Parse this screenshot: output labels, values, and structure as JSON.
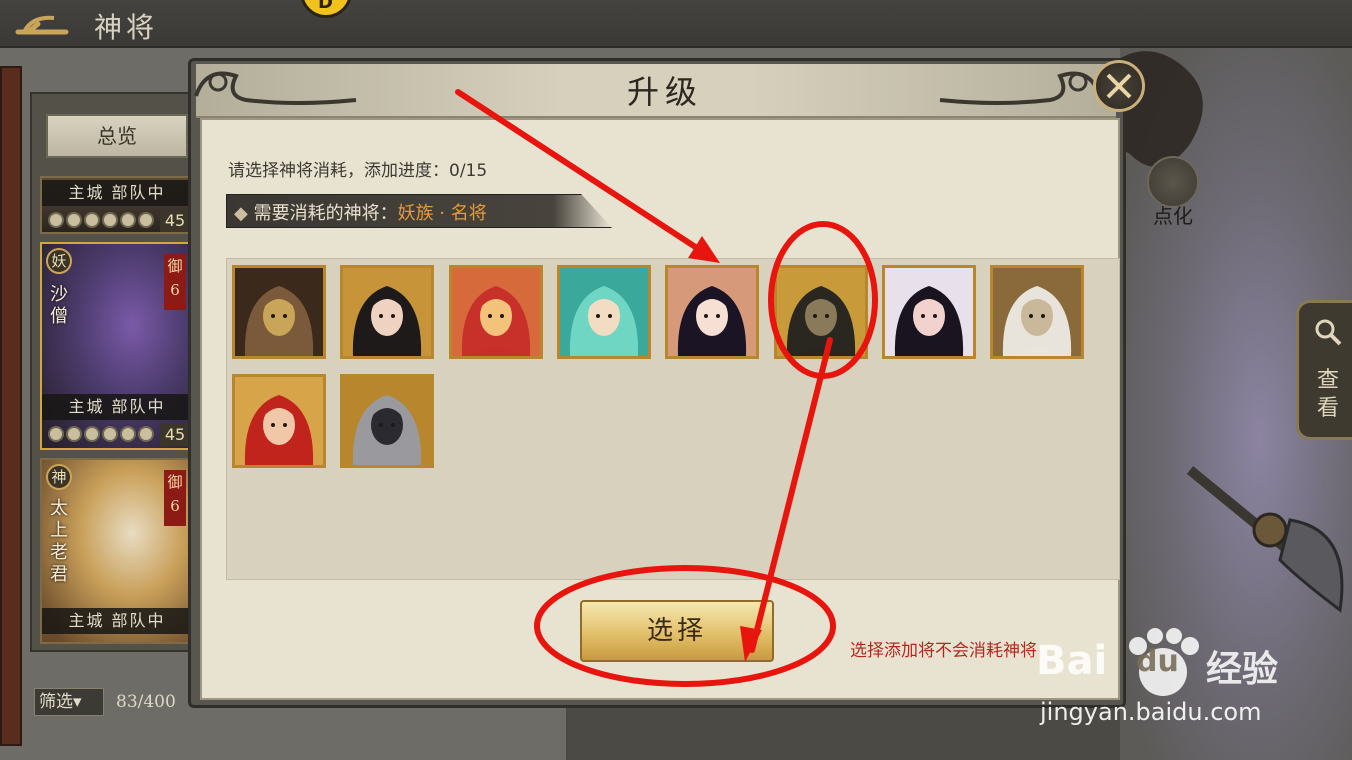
{
  "screen": {
    "title": "神将"
  },
  "side_buttons": {
    "dianhua": "点化",
    "chakan": "查看"
  },
  "roster": {
    "overview_label": "总览",
    "cards": [
      {
        "status": "主城 部队中",
        "level": "45"
      },
      {
        "faction": "妖",
        "name": "沙僧",
        "rank": "御6",
        "status": "主城 部队中",
        "level": "45"
      },
      {
        "faction": "神",
        "name": "太上老君",
        "rank": "御6",
        "status": "主城 部队中"
      }
    ],
    "filter_label": "筛选▾",
    "count": "83/400"
  },
  "dialog": {
    "title": "升级",
    "prompt_prefix": "请选择神将消耗，添加进度：",
    "prompt_progress": "0/15",
    "requirement_label": "需要消耗的神将：",
    "requirement_value": "妖族 · 名将",
    "select_button": "选择",
    "note": "选择添加将不会消耗神将"
  },
  "hero_tiles": [
    {
      "icon": "hero-portrait-lion-demon",
      "colors": [
        "#3b2a1c",
        "#7a5a3a",
        "#c9a55a"
      ]
    },
    {
      "icon": "hero-portrait-black-hair-maiden",
      "colors": [
        "#c8943a",
        "#1f1a1a",
        "#f0d2c0"
      ]
    },
    {
      "icon": "hero-portrait-red-flame-boy",
      "colors": [
        "#d66a3a",
        "#c8302a",
        "#f4c27a"
      ]
    },
    {
      "icon": "hero-portrait-teal-hair-warrior",
      "colors": [
        "#3aa89a",
        "#6fd6c4",
        "#f2dcc2"
      ]
    },
    {
      "icon": "hero-portrait-flower-princess",
      "colors": [
        "#d69a7a",
        "#1a1424",
        "#f6e0d4"
      ]
    },
    {
      "icon": "hero-portrait-dark-bearded-man",
      "colors": [
        "#c89a3a",
        "#2a2620",
        "#8a7a5a"
      ]
    },
    {
      "icon": "hero-portrait-fox-lady",
      "colors": [
        "#e8e0ea",
        "#1a1420",
        "#f2d2cc"
      ]
    },
    {
      "icon": "hero-portrait-white-hair-elder",
      "colors": [
        "#8a6a3a",
        "#e8e4dc",
        "#c9b89a"
      ]
    },
    {
      "icon": "hero-portrait-red-hair-youth",
      "colors": [
        "#d8a44a",
        "#c0241c",
        "#f0c8a8"
      ]
    },
    {
      "icon": "hero-portrait-armored-skull-general",
      "colors": [
        "#b8862c",
        "#9a9a9e",
        "#2a2a30"
      ]
    }
  ],
  "watermark": {
    "brand": "Bai",
    "du": "du",
    "cn": "经验",
    "url": "jingyan.baidu.com"
  },
  "colors": {
    "annotation_red": "#e8150f",
    "button_gold": "#e2c06b",
    "accent_orange": "#e59a3b"
  }
}
